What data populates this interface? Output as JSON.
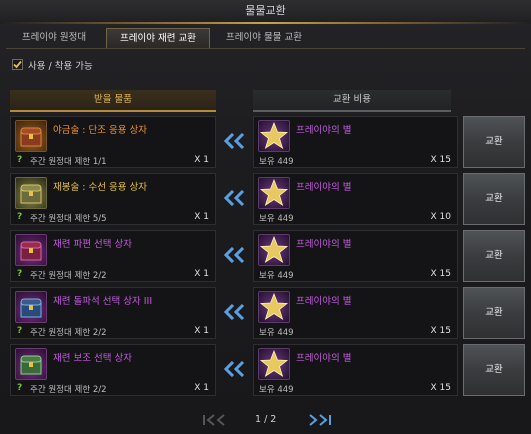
{
  "window": {
    "title": "물물교환"
  },
  "tabs": [
    {
      "label": "프레이야 원정대",
      "active": false
    },
    {
      "label": "프레이야 재련 교환",
      "active": true
    },
    {
      "label": "프레이야 물물 교환",
      "active": false
    }
  ],
  "filter": {
    "label": "사용 / 착용 가능",
    "checked": true
  },
  "headers": {
    "receive": "받을 물품",
    "cost": "교환 비용"
  },
  "cost_item": {
    "name": "프레이야의 별",
    "owned_label": "보유 449"
  },
  "exchange_button": "교환",
  "rows": [
    {
      "name": "야금술 : 단조 응용 상자",
      "limit": "주간 원정대 제한 1/1",
      "qty": "X 1",
      "cost_qty": "X 15"
    },
    {
      "name": "재봉술 : 수선 응용 상자",
      "limit": "주간 원정대 제한 5/5",
      "qty": "X 1",
      "cost_qty": "X 10"
    },
    {
      "name": "재련 파편 선택 상자",
      "limit": "주간 원정대 제한 2/2",
      "qty": "X 1",
      "cost_qty": "X 15"
    },
    {
      "name": "재련 돌파석 선택 상자 III",
      "limit": "주간 원정대 제한 2/2",
      "qty": "X 1",
      "cost_qty": "X 15"
    },
    {
      "name": "재련 보조 선택 상자",
      "limit": "주간 원정대 제한 2/2",
      "qty": "X 1",
      "cost_qty": "X 15"
    }
  ],
  "pager": {
    "text": "1 / 2"
  },
  "colors": {
    "orange": "#f0922e",
    "gold": "#e6c24a",
    "purple": "#c45ae0",
    "accent": "#b58a3a"
  }
}
